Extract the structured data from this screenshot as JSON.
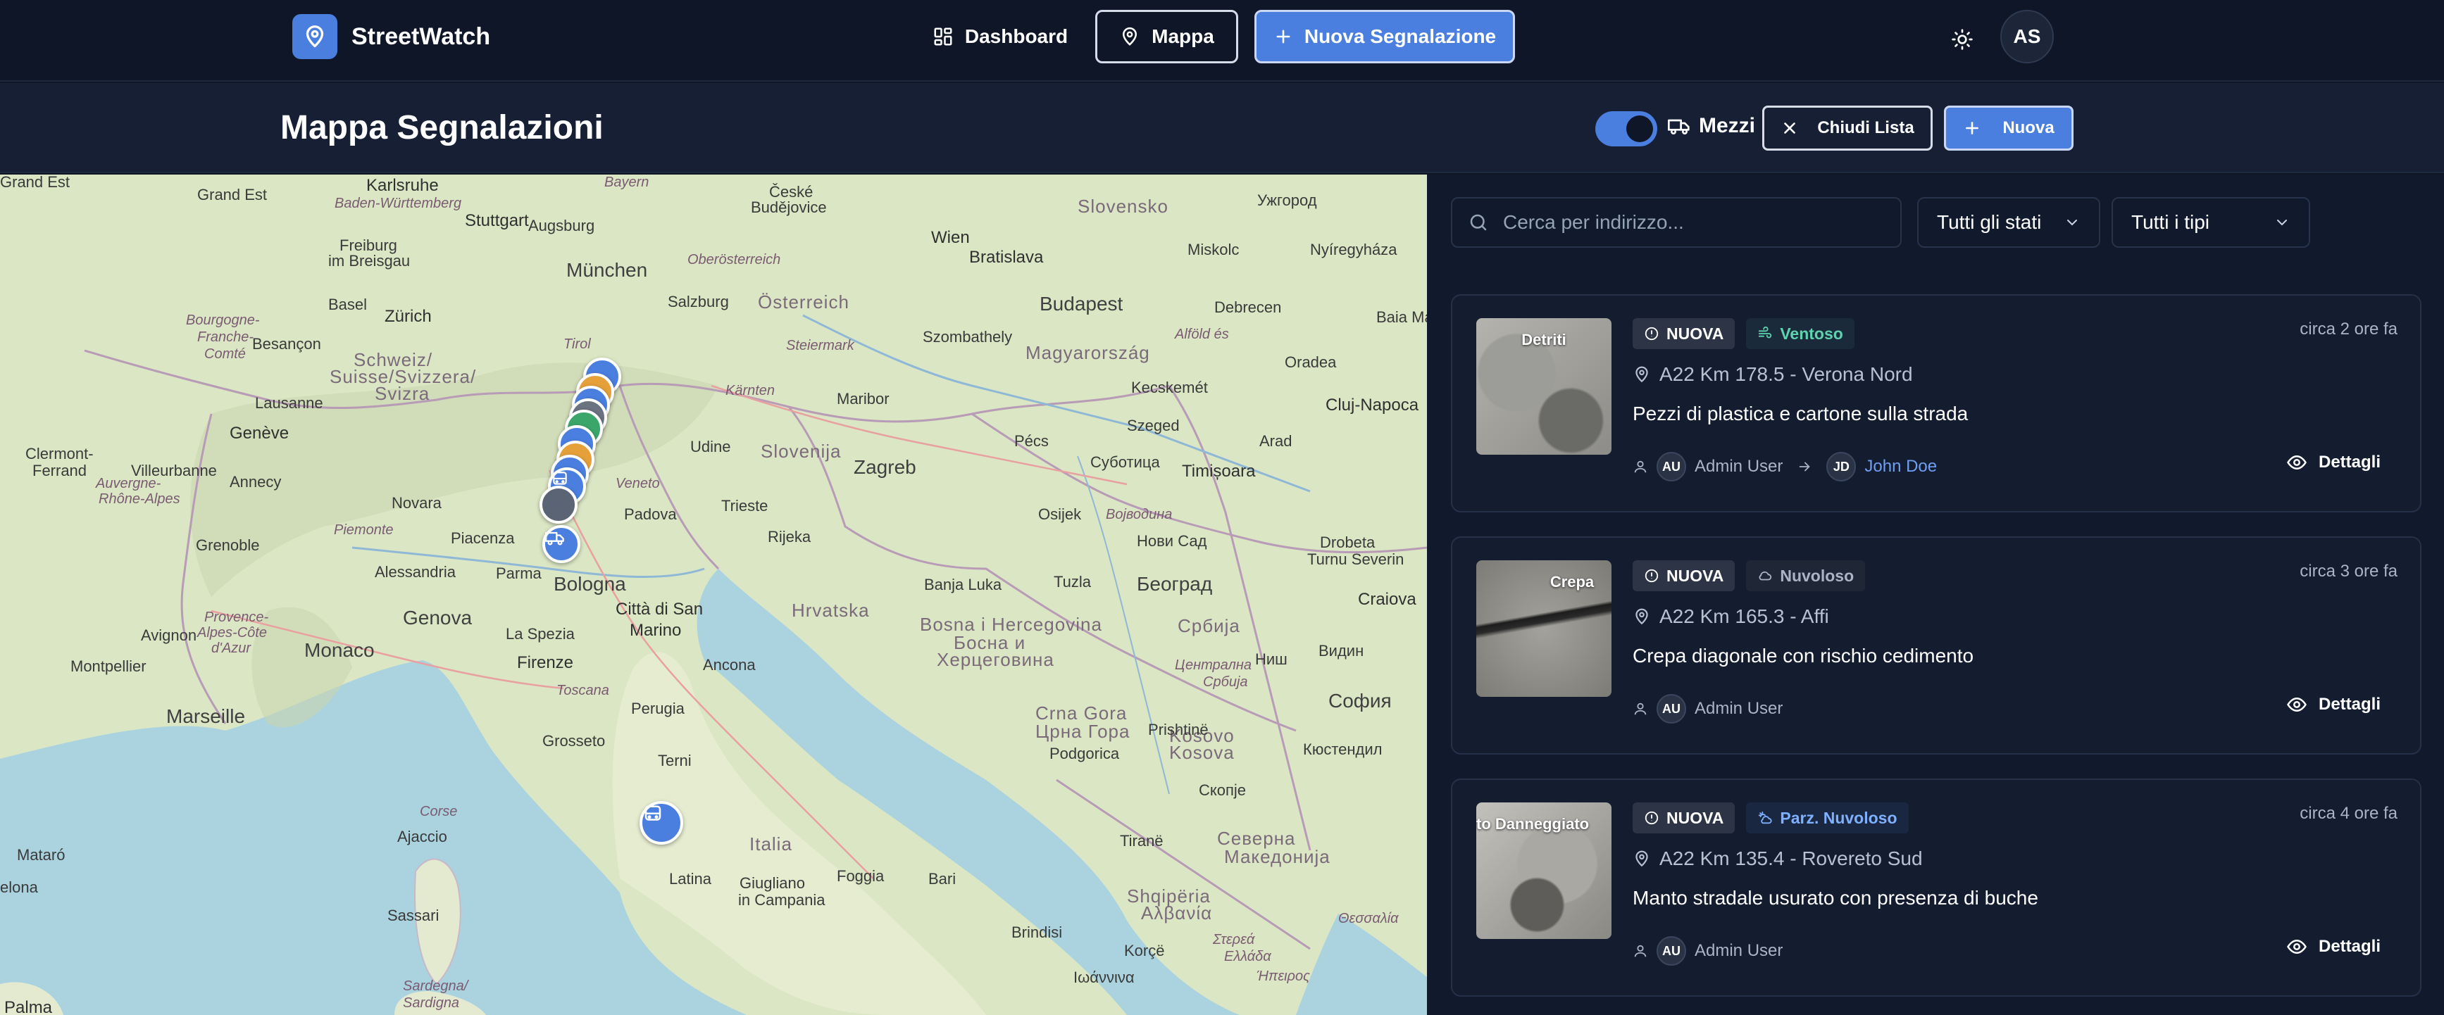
{
  "navbar": {
    "brand": "StreetWatch",
    "logo_icon": "map-pin-icon",
    "dashboard_label": "Dashboard",
    "mappa_label": "Mappa",
    "new_report_label": "Nuova Segnalazione",
    "theme_icon": "sun-icon",
    "user_initials": "AS",
    "accent_color": "#4a7fe0"
  },
  "header": {
    "title": "Mappa Segnalazioni",
    "vehicles_toggle_on": true,
    "vehicles_label": "Mezzi",
    "close_list_label": "Chiudi Lista",
    "new_label": "Nuova"
  },
  "map": {
    "labels": {
      "karlsruhe": "Karlsruhe",
      "baden": "Baden-Württemberg",
      "stuttgart": "Stuttgart",
      "bayern": "Bayern",
      "ceske": "České",
      "budejovice": "Budějovice",
      "augsburg": "Augsburg",
      "grandest": "Grand Est",
      "slovensko": "Slovensko",
      "uzhhorod": "Ужгород",
      "wien": "Wien",
      "oberosterreich": "Oberösterreich",
      "bratislava": "Bratislava",
      "freiburg": "Freiburg",
      "imbreisgau": "im Breisgau",
      "munchen": "München",
      "miskolc": "Miskolc",
      "nyiregyhaza": "Nyíregyháza",
      "zurich": "Zürich",
      "basel": "Basel",
      "salzburg": "Salzburg",
      "osterreich": "Österreich",
      "budapest": "Budapest",
      "debrecen": "Debrecen",
      "bourgogne": "Bourgogne-",
      "franche": "Franche-",
      "comte": "Comté",
      "besancon": "Besançon",
      "steiermark": "Steiermark",
      "szombathely": "Szombathely",
      "magyarorszag": "Magyarország",
      "alfold": "Alföld és",
      "baia": "Baia Ma",
      "schweiz": "Schweiz/",
      "suisse": "Suisse/Svizzera/",
      "svizra": "Svizra",
      "tirol": "Tirol",
      "oradea": "Oradea",
      "kecskemet": "Kecskemét",
      "lausanne": "Lausanne",
      "karnten": "Kärnten",
      "maribor": "Maribor",
      "geneve": "Genève",
      "zagreb": "Zagreb",
      "szeged": "Szeged",
      "clujnapoca": "Cluj-Napoca",
      "clermont": "Clermont-",
      "ferrand": "Ferrand",
      "udine": "Udine",
      "slovenija": "Slovenija",
      "pecs": "Pécs",
      "arad": "Arad",
      "villeurbanne": "Villeurbanne",
      "annecy": "Annecy",
      "subotica": "Суботица",
      "timisoara": "Timișoara",
      "auvergne": "Auvergne-",
      "rhone": "Rhône-Alpes",
      "veneto": "Veneto",
      "trieste": "Trieste",
      "novara": "Novara",
      "padova": "Padova",
      "osijek": "Osijek",
      "vojvodina": "Војводина",
      "piemonte": "Piemonte",
      "grenoble": "Grenoble",
      "rijeka": "Rijeka",
      "novisad": "Нови Сад",
      "drobeta": "Drobeta",
      "turnu": "Turnu Severin",
      "piacenza": "Piacenza",
      "parma": "Parma",
      "banjaluka": "Banja Luka",
      "tuzla": "Tuzla",
      "beograd": "Београд",
      "alessandria": "Alessandria",
      "bologna": "Bologna",
      "cittadisan": "Città di San",
      "craiova": "Craiova",
      "marino": "Marino",
      "hrvatska": "Hrvatska",
      "srbija": "Србија",
      "avignon": "Avignon",
      "genova": "Genova",
      "provence": "Provence-",
      "alpes": "Alpes-Côte",
      "dazur": "d'Azur",
      "bosna": "Bosna i Hercegovina",
      "bosnia": "Босна и",
      "herceg": "Херцеговина",
      "niš": "Ниш",
      "vidin": "Видин",
      "monaco": "Monaco",
      "laspezia": "La Spezia",
      "ancona": "Ancona",
      "montpellier": "Montpellier",
      "firenze": "Firenze",
      "centralna": "Централна",
      "srbijabig": "Србија",
      "toscana": "Toscana",
      "perugia": "Perugia",
      "marseille": "Marseille",
      "crnagora": "Crna Gora",
      "crnagora2": "Црна Гора",
      "kosovo": "Kosovo",
      "kosovo2": "Kosova",
      "sofia": "София",
      "grosseto": "Grosseto",
      "terni": "Terni",
      "podgorica": "Podgorica",
      "prishtina": "Prishtinë",
      "corse": "Corse",
      "ajaccio": "Ajaccio",
      "skopje": "Скопје",
      "italia": "Italia",
      "severna": "Северна",
      "makedonija": "Македонија",
      "mataro": "Mataró",
      "latina": "Latina",
      "giugliano": "Giugliano",
      "incampania": "in Campania",
      "foggia": "Foggia",
      "bari": "Bari",
      "sassari": "Sassari",
      "brindisi": "Brindisi",
      "barcelona": "elona",
      "sardegna": "Sardegna/",
      "sardigna": "Sardigna",
      "palma": "Palma",
      "ioannina": "Ιωάννινα",
      "epeiros": "Ήπειρος",
      "tirane": "Tiranë",
      "shqiperia": "Shqipëria",
      "kyustendil": "Кюстендил",
      "albania": "Αλβανία",
      "sterea": "Στερεά",
      "ellada": "Ελλάδα",
      "thessalia": "Θεσσαλία",
      "korce": "Korçë"
    },
    "markers": [
      {
        "color": "#4a7fe0",
        "icon": "report-marker-icon"
      },
      {
        "color": "#e5a03a",
        "icon": "report-marker-icon"
      },
      {
        "color": "#4a7fe0",
        "icon": "report-marker-icon"
      },
      {
        "color": "#6b7280",
        "icon": "report-marker-icon"
      },
      {
        "color": "#3aa66a",
        "icon": "report-marker-icon"
      },
      {
        "color": "#4a7fe0",
        "icon": "report-marker-icon"
      },
      {
        "color": "#e5a03a",
        "icon": "report-marker-icon"
      },
      {
        "color": "#4a7fe0",
        "icon": "bus-icon"
      },
      {
        "color": "#5b6475",
        "icon": "report-marker-icon"
      },
      {
        "color": "#4a7fe0",
        "icon": "truck-icon"
      },
      {
        "color": "#4a7fe0",
        "icon": "bus-icon"
      }
    ]
  },
  "filters": {
    "search_placeholder": "Cerca per indirizzo...",
    "status_select": "Tutti gli stati",
    "type_select": "Tutti i tipi"
  },
  "reports": [
    {
      "thumb_label": "Detriti",
      "status": "NUOVA",
      "weather": "Ventoso",
      "weather_icon": "wind-icon",
      "weather_color": "#5fd3b0",
      "time": "circa 2 ore fa",
      "address": "A22 Km 178.5 - Verona Nord",
      "description": "Pezzi di plastica e cartone sulla strada",
      "reporter_initials": "AU",
      "reporter": "Admin User",
      "assignee_initials": "JD",
      "assignee": "John Doe",
      "details_label": "Dettagli"
    },
    {
      "thumb_label": "Crepa",
      "status": "NUOVA",
      "weather": "Nuvoloso",
      "weather_icon": "cloud-icon",
      "weather_color": "#aab4c5",
      "time": "circa 3 ore fa",
      "address": "A22 Km 165.3 - Affi",
      "description": "Crepa diagonale con rischio cedimento",
      "reporter_initials": "AU",
      "reporter": "Admin User",
      "details_label": "Dettagli"
    },
    {
      "thumb_label": "to Danneggiato",
      "status": "NUOVA",
      "weather": "Parz. Nuvoloso",
      "weather_icon": "cloud-sun-icon",
      "weather_color": "#7fb0ff",
      "time": "circa 4 ore fa",
      "address": "A22 Km 135.4 - Rovereto Sud",
      "description": "Manto stradale usurato con presenza di buche",
      "reporter_initials": "AU",
      "reporter": "Admin User",
      "details_label": "Dettagli"
    }
  ]
}
